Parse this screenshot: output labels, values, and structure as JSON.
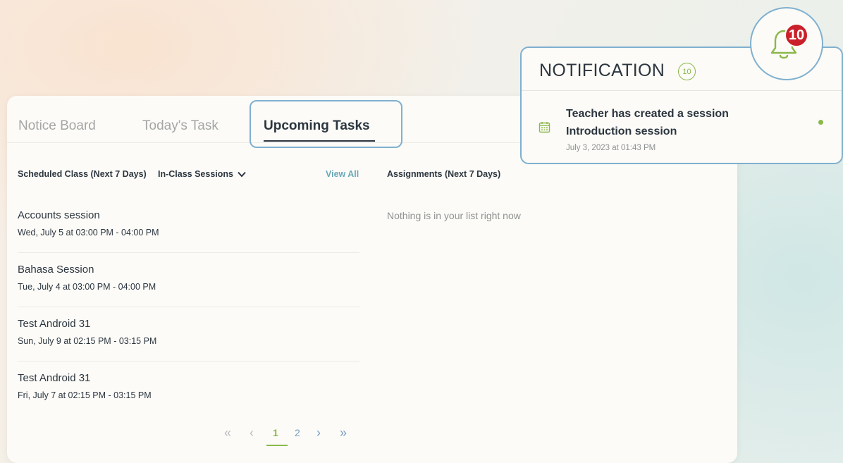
{
  "tabs": [
    {
      "label": "Notice Board"
    },
    {
      "label": "Today's Task"
    },
    {
      "label": "Upcoming Tasks"
    }
  ],
  "scheduled": {
    "label": "Scheduled Class (Next 7 Days)",
    "filter": "In-Class Sessions",
    "view_all": "View All"
  },
  "sessions": [
    {
      "name": "Accounts session",
      "time": "Wed, July 5 at 03:00 PM - 04:00 PM"
    },
    {
      "name": "Bahasa Session",
      "time": "Tue, July 4 at 03:00 PM - 04:00 PM"
    },
    {
      "name": "Test Android 31",
      "time": "Sun, July 9 at 02:15 PM - 03:15 PM"
    },
    {
      "name": "Test Android 31",
      "time": "Fri, July 7 at 02:15 PM - 03:15 PM"
    }
  ],
  "pagination": {
    "first": "«",
    "prev": "‹",
    "pages": [
      "1",
      "2"
    ],
    "current": "1",
    "next": "›",
    "last": "»"
  },
  "assignments": {
    "label": "Assignments (Next 7 Days)",
    "empty": "Nothing is in your list right now"
  },
  "notification": {
    "title": "NOTIFICATION",
    "count": "10",
    "badge": "10",
    "item": {
      "line1": "Teacher has created a session",
      "line2": "Introduction session",
      "date": "July 3, 2023 at 01:43 PM",
      "icon": "calendar-icon"
    },
    "bell_icon": "bell-icon"
  },
  "colors": {
    "accent_green": "#8ab84a",
    "highlight_blue": "#7fb0cf",
    "badge_red": "#c9202a",
    "text_dark": "#2c3640"
  }
}
